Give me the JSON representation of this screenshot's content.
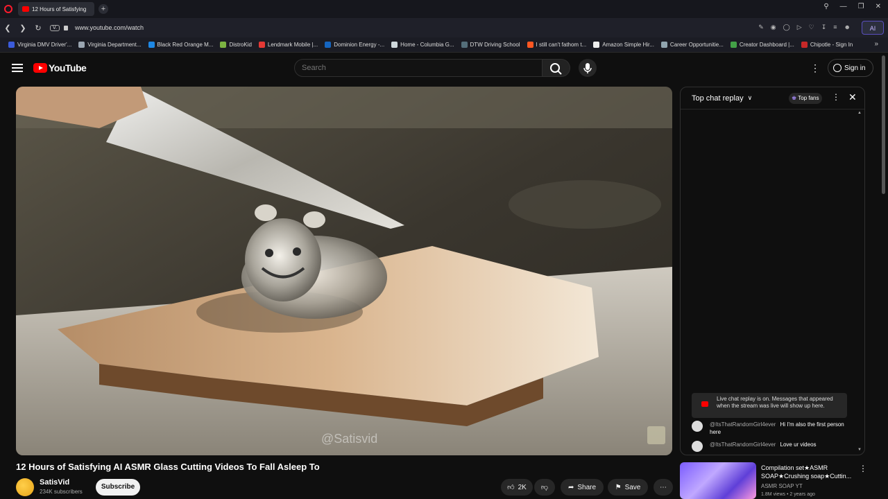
{
  "browser": {
    "tab_title": "12 Hours of Satisfying",
    "url": "www.youtube.com/watch",
    "vpn_label": "V.",
    "ai_label": "AI",
    "bookmarks": [
      {
        "label": "Virginia DMV Driver'...",
        "color": "#3b5bdb"
      },
      {
        "label": "Virginia Department...",
        "color": "#9aa5b1"
      },
      {
        "label": "Black Red Orange M...",
        "color": "#1e88e5"
      },
      {
        "label": "DistroKid",
        "color": "#7cb342"
      },
      {
        "label": "Lendmark Mobile |...",
        "color": "#e53935"
      },
      {
        "label": "Dominion Energy -...",
        "color": "#1565c0"
      },
      {
        "label": "Home - Columbia G...",
        "color": "#cfd8dc"
      },
      {
        "label": "DTW Driving School",
        "color": "#546e7a"
      },
      {
        "label": "I still can't fathom t...",
        "color": "#ff5722"
      },
      {
        "label": "Amazon Simple Hir...",
        "color": "#eeeeee"
      },
      {
        "label": "Career Opportunitie...",
        "color": "#90a4ae"
      },
      {
        "label": "Creator Dashboard |...",
        "color": "#43a047"
      },
      {
        "label": "Chipotle - Sign In",
        "color": "#c62828"
      }
    ]
  },
  "youtube": {
    "logo_text": "YouTube",
    "search_placeholder": "Search",
    "signin_label": "Sign in"
  },
  "video": {
    "title": "12 Hours of Satisfying AI ASMR Glass Cutting Videos To Fall Asleep To",
    "watermark": "@Satisvid",
    "channel_name": "SatisVid",
    "channel_subs": "234K subscribers",
    "subscribe_label": "Subscribe",
    "like_count": "2K",
    "share_label": "Share",
    "save_label": "Save"
  },
  "chat": {
    "header_label": "Top chat replay",
    "top_fans_label": "Top fans",
    "notice": "Live chat replay is on. Messages that appeared when the stream was live will show up here.",
    "messages": [
      {
        "author": "@ItsThatRandomGirl4ever",
        "text": "Hi I'm also the first person here"
      },
      {
        "author": "@ItsThatRandomGirl4ever",
        "text": "Love ur videos"
      }
    ]
  },
  "recommendation": {
    "title": "Compilation set★ASMR SOAP★Crushing soap★Cuttin...",
    "channel": "ASMR SOAP YT",
    "meta": "1.8M views • 2 years ago"
  }
}
